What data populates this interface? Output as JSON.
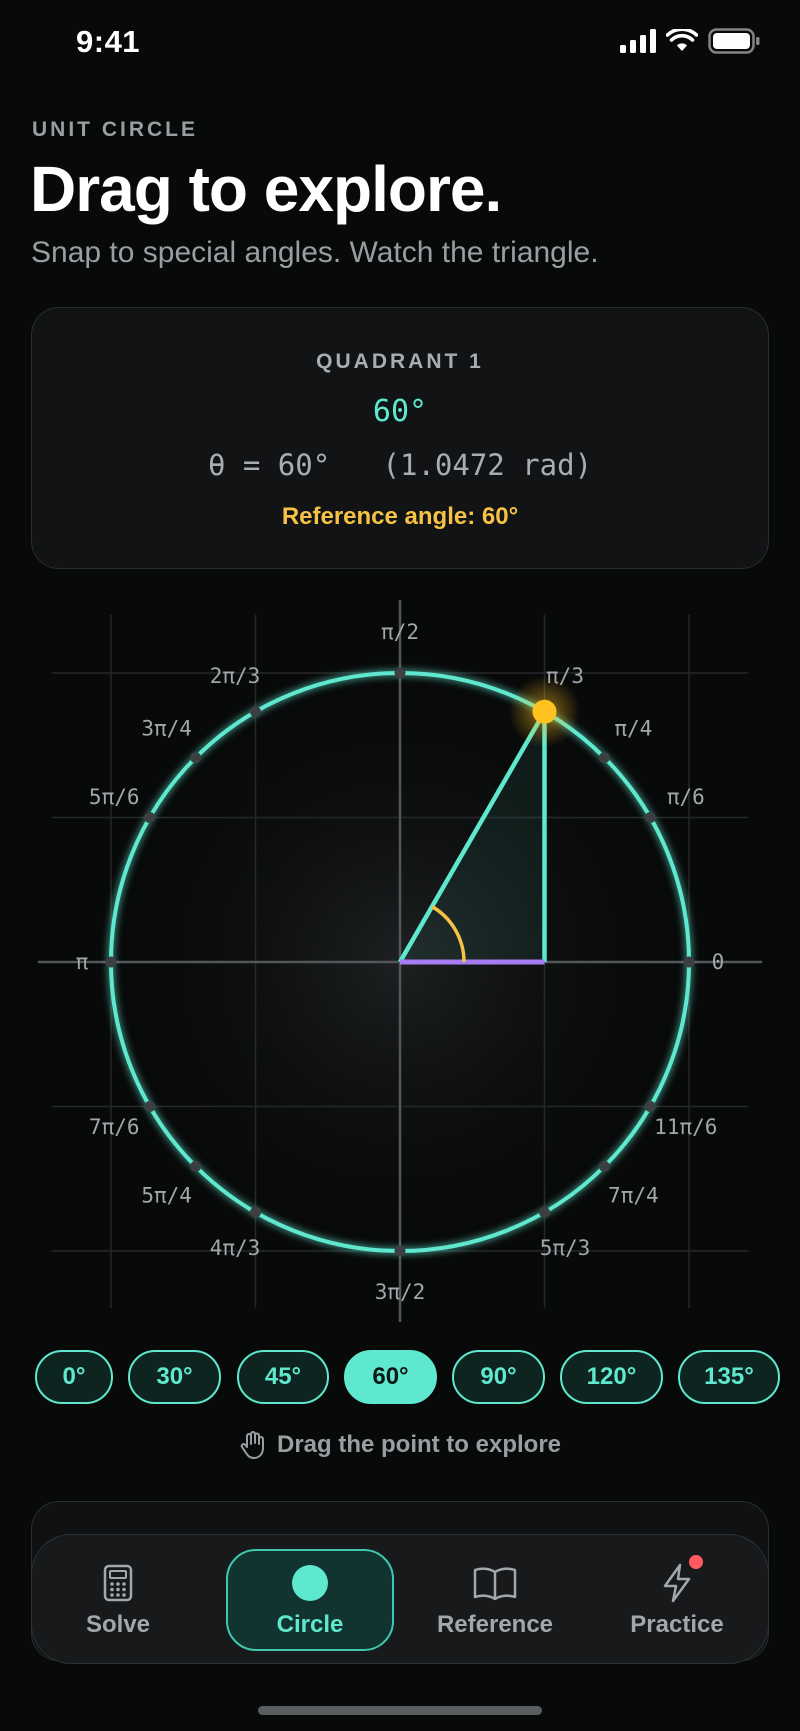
{
  "status": {
    "time": "9:41"
  },
  "header": {
    "eyebrow": "UNIT CIRCLE",
    "title": "Drag to explore.",
    "subtitle": "Snap to special angles. Watch the triangle."
  },
  "info": {
    "quadrant": "QUADRANT 1",
    "degrees": "60°",
    "formula": "θ = 60°   (1.0472 rad)",
    "reference": "Reference angle: 60°"
  },
  "circle": {
    "selected_angle_deg": 60,
    "colors": {
      "ring": "#5ee8cf",
      "point": "#ffc21f",
      "angle_arc": "#f6c243",
      "cos_leg": "#a67cf5"
    },
    "labels": [
      {
        "deg": 0,
        "text": "0"
      },
      {
        "deg": 30,
        "text": "π/6"
      },
      {
        "deg": 45,
        "text": "π/4"
      },
      {
        "deg": 60,
        "text": "π/3"
      },
      {
        "deg": 90,
        "text": "π/2"
      },
      {
        "deg": 120,
        "text": "2π/3"
      },
      {
        "deg": 135,
        "text": "3π/4"
      },
      {
        "deg": 150,
        "text": "5π/6"
      },
      {
        "deg": 180,
        "text": "π"
      },
      {
        "deg": 210,
        "text": "7π/6"
      },
      {
        "deg": 225,
        "text": "5π/4"
      },
      {
        "deg": 240,
        "text": "4π/3"
      },
      {
        "deg": 270,
        "text": "3π/2"
      },
      {
        "deg": 300,
        "text": "5π/3"
      },
      {
        "deg": 315,
        "text": "7π/4"
      },
      {
        "deg": 330,
        "text": "11π/6"
      }
    ]
  },
  "chips": [
    {
      "label": "0°",
      "active": false
    },
    {
      "label": "30°",
      "active": false
    },
    {
      "label": "45°",
      "active": false
    },
    {
      "label": "60°",
      "active": true
    },
    {
      "label": "90°",
      "active": false
    },
    {
      "label": "120°",
      "active": false
    },
    {
      "label": "135°",
      "active": false
    }
  ],
  "hint": "Drag the point to explore",
  "tabs": [
    {
      "label": "Solve",
      "icon": "calculator-icon"
    },
    {
      "label": "Circle",
      "icon": "circle-icon"
    },
    {
      "label": "Reference",
      "icon": "book-icon"
    },
    {
      "label": "Practice",
      "icon": "lightning-icon"
    }
  ]
}
